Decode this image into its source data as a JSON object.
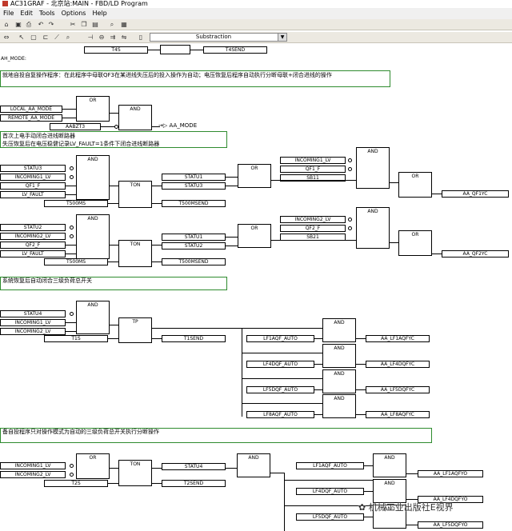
{
  "window": {
    "title": "AC31GRAF - 北京站:MAIN - FBD/LD Program"
  },
  "menu": [
    "File",
    "Edit",
    "Tools",
    "Options",
    "Help"
  ],
  "toolbar": {
    "combo_value": "Substraction"
  },
  "canvas": {
    "section_label": "AH_MODE:",
    "comments": {
      "c1": "就地自投自复操作程序：在此程序中母联QF3在某进线失压后的投入操作为自动；电压恢复后程序自动执行分断母联+闭合进线的操作",
      "c2a": "首次上电手动闭合进线断路器",
      "c2b": "失压恢复后在电压稳健记录LV_FAULT=1条件下闭合进线断路器",
      "c3": "系统恢复后自动闭合三级负荷总开关",
      "c4": "备自投程序只对操作模式为自动的三级负荷总开关执行分断操作"
    },
    "blocks": {
      "or": "OR",
      "and": "AND",
      "ton": "TON",
      "tp": "TP"
    },
    "fields": {
      "t4s": "T4S",
      "t4send": "T4SEND",
      "local_aa": "LOCAL_AA_MODE",
      "remote_aa": "REMOTE_AA_MODE",
      "aabzt3": "AABZT3",
      "aa_mode": "AA_MODE",
      "status3": "STATU3",
      "incoming1": "INCOMING1_LV",
      "qf1f": "QF1_F",
      "lvfault": "LV_FAULT",
      "t500ms": "T500MS",
      "statu1": "STATU1",
      "statu3": "STATU3",
      "t500msend": "T500MSEND",
      "inc1b": "INCOMING1_LV",
      "qf1f2": "QF1_F",
      "sb11": "SB11",
      "aaqf1yc": "AA_QF1YC",
      "statu2": "STATU2",
      "incoming2": "INCOMING2_LV",
      "qf2f": "QF2_F",
      "lvfault2": "LV_FAULT",
      "t500ms2": "T500MS",
      "statu1b": "STATU1",
      "statu2b": "STATU2",
      "t500msend2": "T500MSEND",
      "inc2b": "INCOMING2_LV",
      "qf2f2": "QF2_F",
      "sb21": "SB21",
      "aaqf2yc": "AA_QF2YC",
      "statu4": "STATU4",
      "inc1c": "INCOMING1_LV",
      "inc2c": "INCOMING2_LV",
      "t1s": "T1S",
      "t1send": "T1SEND",
      "lf1": "LF1AQF_AUTO",
      "lf4": "LF4DQF_AUTO",
      "lf5": "LF5DQF_AUTO",
      "lf8": "LF8AQF_AUTO",
      "o_lf1": "AA_LF1AQFYC",
      "o_lf4": "AA_LF4DQFYC",
      "o_lf5": "AA_LF5DQFYC",
      "o_lf8": "AA_LF8AQFYC",
      "inc1d": "INCOMING1_LV",
      "inc2d": "INCOMING2_LV",
      "t2s": "T2S",
      "statu4b": "STATU4",
      "t2send": "T2SEND",
      "lf1b": "LF1AQF_AUTO",
      "lf4b": "LF4DQF_AUTO",
      "lf5b": "LF5DQF_AUTO",
      "o_lf1b": "AA_LF1AQFYO",
      "o_lf4b": "AA_LF4DQFYO",
      "o_lf5b": "AA_LF5DQFYO"
    }
  },
  "watermark": "机械工业出版社E视界"
}
